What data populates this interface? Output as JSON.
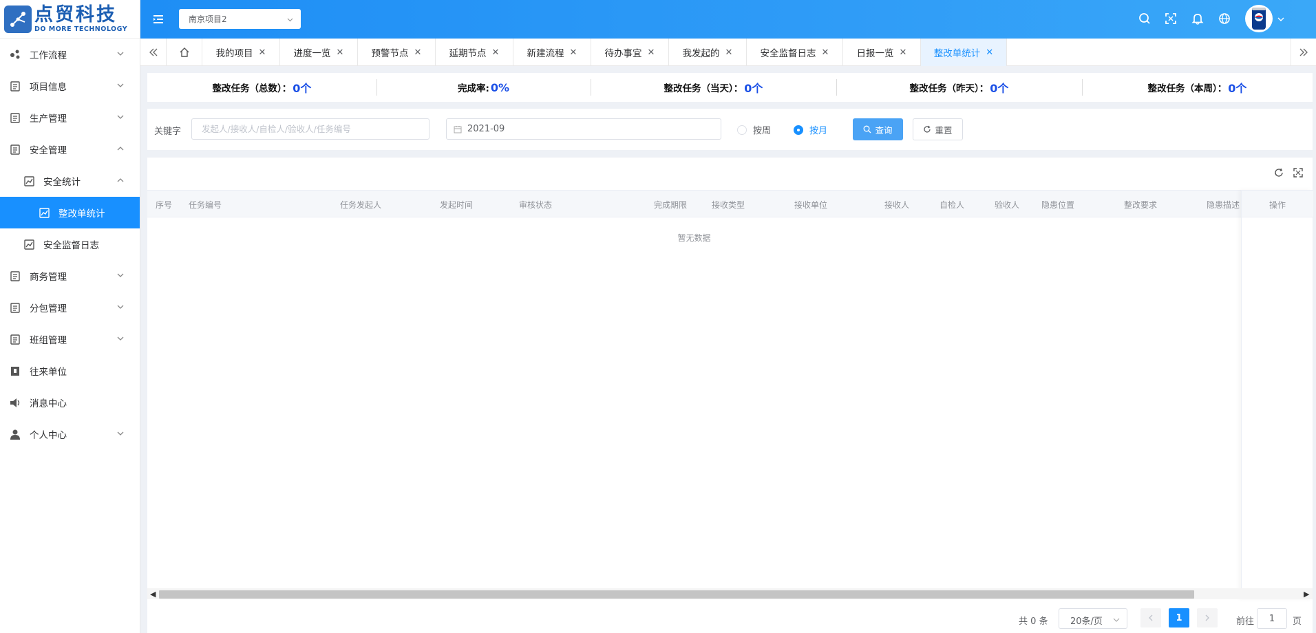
{
  "brand": {
    "name_cn": "点贸科技",
    "name_en": "DO MORE TECHNOLOGY"
  },
  "sidebar": {
    "items": [
      {
        "label": "工作流程",
        "icon": "workflow-icon",
        "expandable": true
      },
      {
        "label": "项目信息",
        "icon": "document-icon",
        "expandable": true
      },
      {
        "label": "生产管理",
        "icon": "document-icon",
        "expandable": true
      },
      {
        "label": "安全管理",
        "icon": "document-icon",
        "expandable": true,
        "expanded": true
      },
      {
        "label": "安全统计",
        "icon": "chart-icon",
        "expandable": true,
        "expanded": true
      },
      {
        "label": "整改单统计",
        "icon": "chart-icon",
        "active": true
      },
      {
        "label": "安全监督日志",
        "icon": "chart-icon"
      },
      {
        "label": "商务管理",
        "icon": "document-icon",
        "expandable": true
      },
      {
        "label": "分包管理",
        "icon": "document-icon",
        "expandable": true
      },
      {
        "label": "班组管理",
        "icon": "document-icon",
        "expandable": true
      },
      {
        "label": "往来单位",
        "icon": "company-icon"
      },
      {
        "label": "消息中心",
        "icon": "speaker-icon"
      },
      {
        "label": "个人中心",
        "icon": "user-icon",
        "expandable": true
      }
    ]
  },
  "header": {
    "project": "南京项目2",
    "icons": [
      "search-icon",
      "fullscreen-icon",
      "bell-icon",
      "globe-icon"
    ]
  },
  "tabs": [
    {
      "label": "我的项目"
    },
    {
      "label": "进度一览"
    },
    {
      "label": "预警节点"
    },
    {
      "label": "延期节点"
    },
    {
      "label": "新建流程"
    },
    {
      "label": "待办事宜"
    },
    {
      "label": "我发起的"
    },
    {
      "label": "安全监督日志"
    },
    {
      "label": "日报一览"
    },
    {
      "label": "整改单统计",
      "active": true
    }
  ],
  "stats": [
    {
      "label": "整改任务（总数）：",
      "value": "0个"
    },
    {
      "label": "完成率:",
      "value": "0%"
    },
    {
      "label": "整改任务（当天）：",
      "value": "0个"
    },
    {
      "label": "整改任务（昨天）：",
      "value": "0个"
    },
    {
      "label": "整改任务（本周）：",
      "value": "0个"
    }
  ],
  "search": {
    "keyword_label": "关键字",
    "keyword_placeholder": "发起人/接收人/自检人/验收人/任务编号",
    "keyword_value": "",
    "date_value": "2021-09",
    "radio_week": "按周",
    "radio_month": "按月",
    "selected_period": "按月",
    "query_button": "查询",
    "reset_button": "重置"
  },
  "table": {
    "columns": [
      "序号",
      "任务编号",
      "任务发起人",
      "发起时间",
      "审核状态",
      "完成期限",
      "接收类型",
      "接收单位",
      "接收人",
      "自检人",
      "验收人",
      "隐患位置",
      "整改要求",
      "隐患描述",
      "操作"
    ],
    "rows": [],
    "empty_text": "暂无数据"
  },
  "pagination": {
    "total_text": "共 0 条",
    "page_size": "20条/页",
    "current_page": "1",
    "goto_label": "前往",
    "goto_value": "1",
    "page_suffix": "页"
  },
  "colors": {
    "primary": "#1890ff",
    "header_gradient_start": "#1e8ef5",
    "stat_value": "#1a4fe6"
  }
}
